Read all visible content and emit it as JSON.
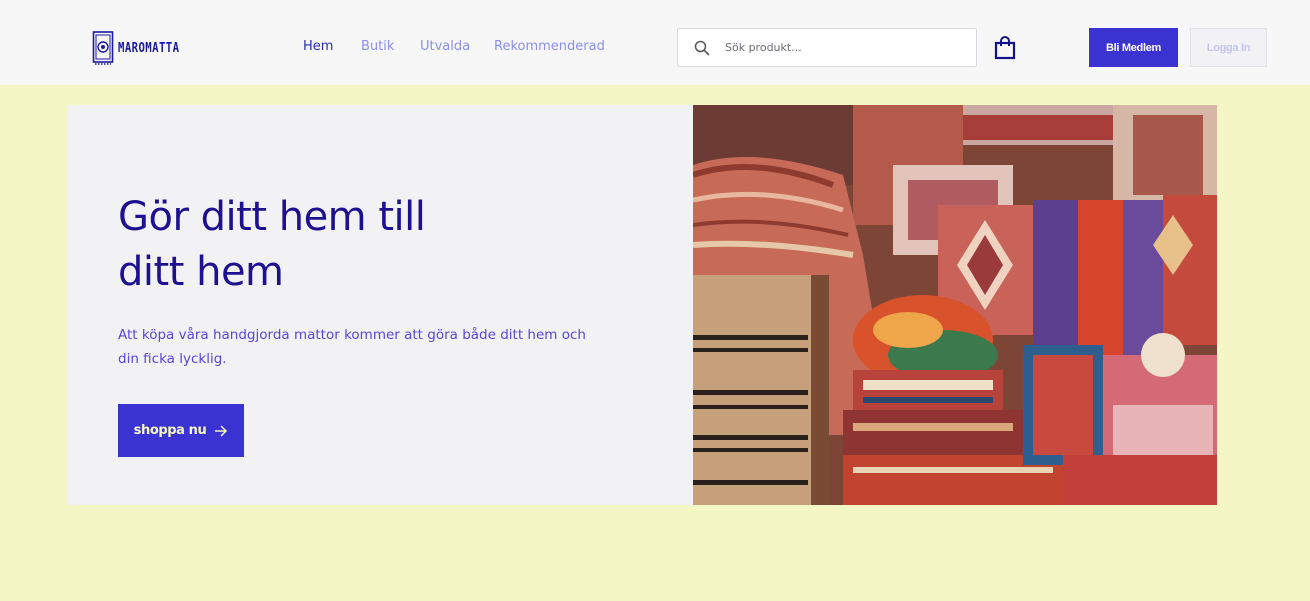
{
  "brand": {
    "name": "MAROMATTA",
    "icon": "rug-logo-icon"
  },
  "nav": {
    "items": [
      {
        "label": "Hem",
        "active": true
      },
      {
        "label": "Butik",
        "active": false
      },
      {
        "label": "Utvalda",
        "active": false
      },
      {
        "label": "Rekommenderad",
        "active": false
      }
    ]
  },
  "search": {
    "placeholder": "Sök produkt...",
    "value": "",
    "icon": "search-icon"
  },
  "cart": {
    "icon": "shopping-bag-icon"
  },
  "auth": {
    "member_label": "Bli Medlem",
    "login_label": "Logga In"
  },
  "hero": {
    "title_line1": "Gör ditt hem till",
    "title_line2": "ditt hem",
    "subtitle": "Att köpa våra handgjorda mattor kommer att göra både ditt hem och din ficka lycklig.",
    "cta_label": "shoppa nu",
    "cta_icon": "arrow-right-icon",
    "image_alt": "Stacked handmade rugs in a market"
  },
  "colors": {
    "page_bg": "#f4f7c5",
    "header_bg": "#f7f7f8",
    "accent": "#3a33d1",
    "title": "#1d1190",
    "subtitle": "#5548d8",
    "nav_inactive": "#8a8ff0"
  }
}
